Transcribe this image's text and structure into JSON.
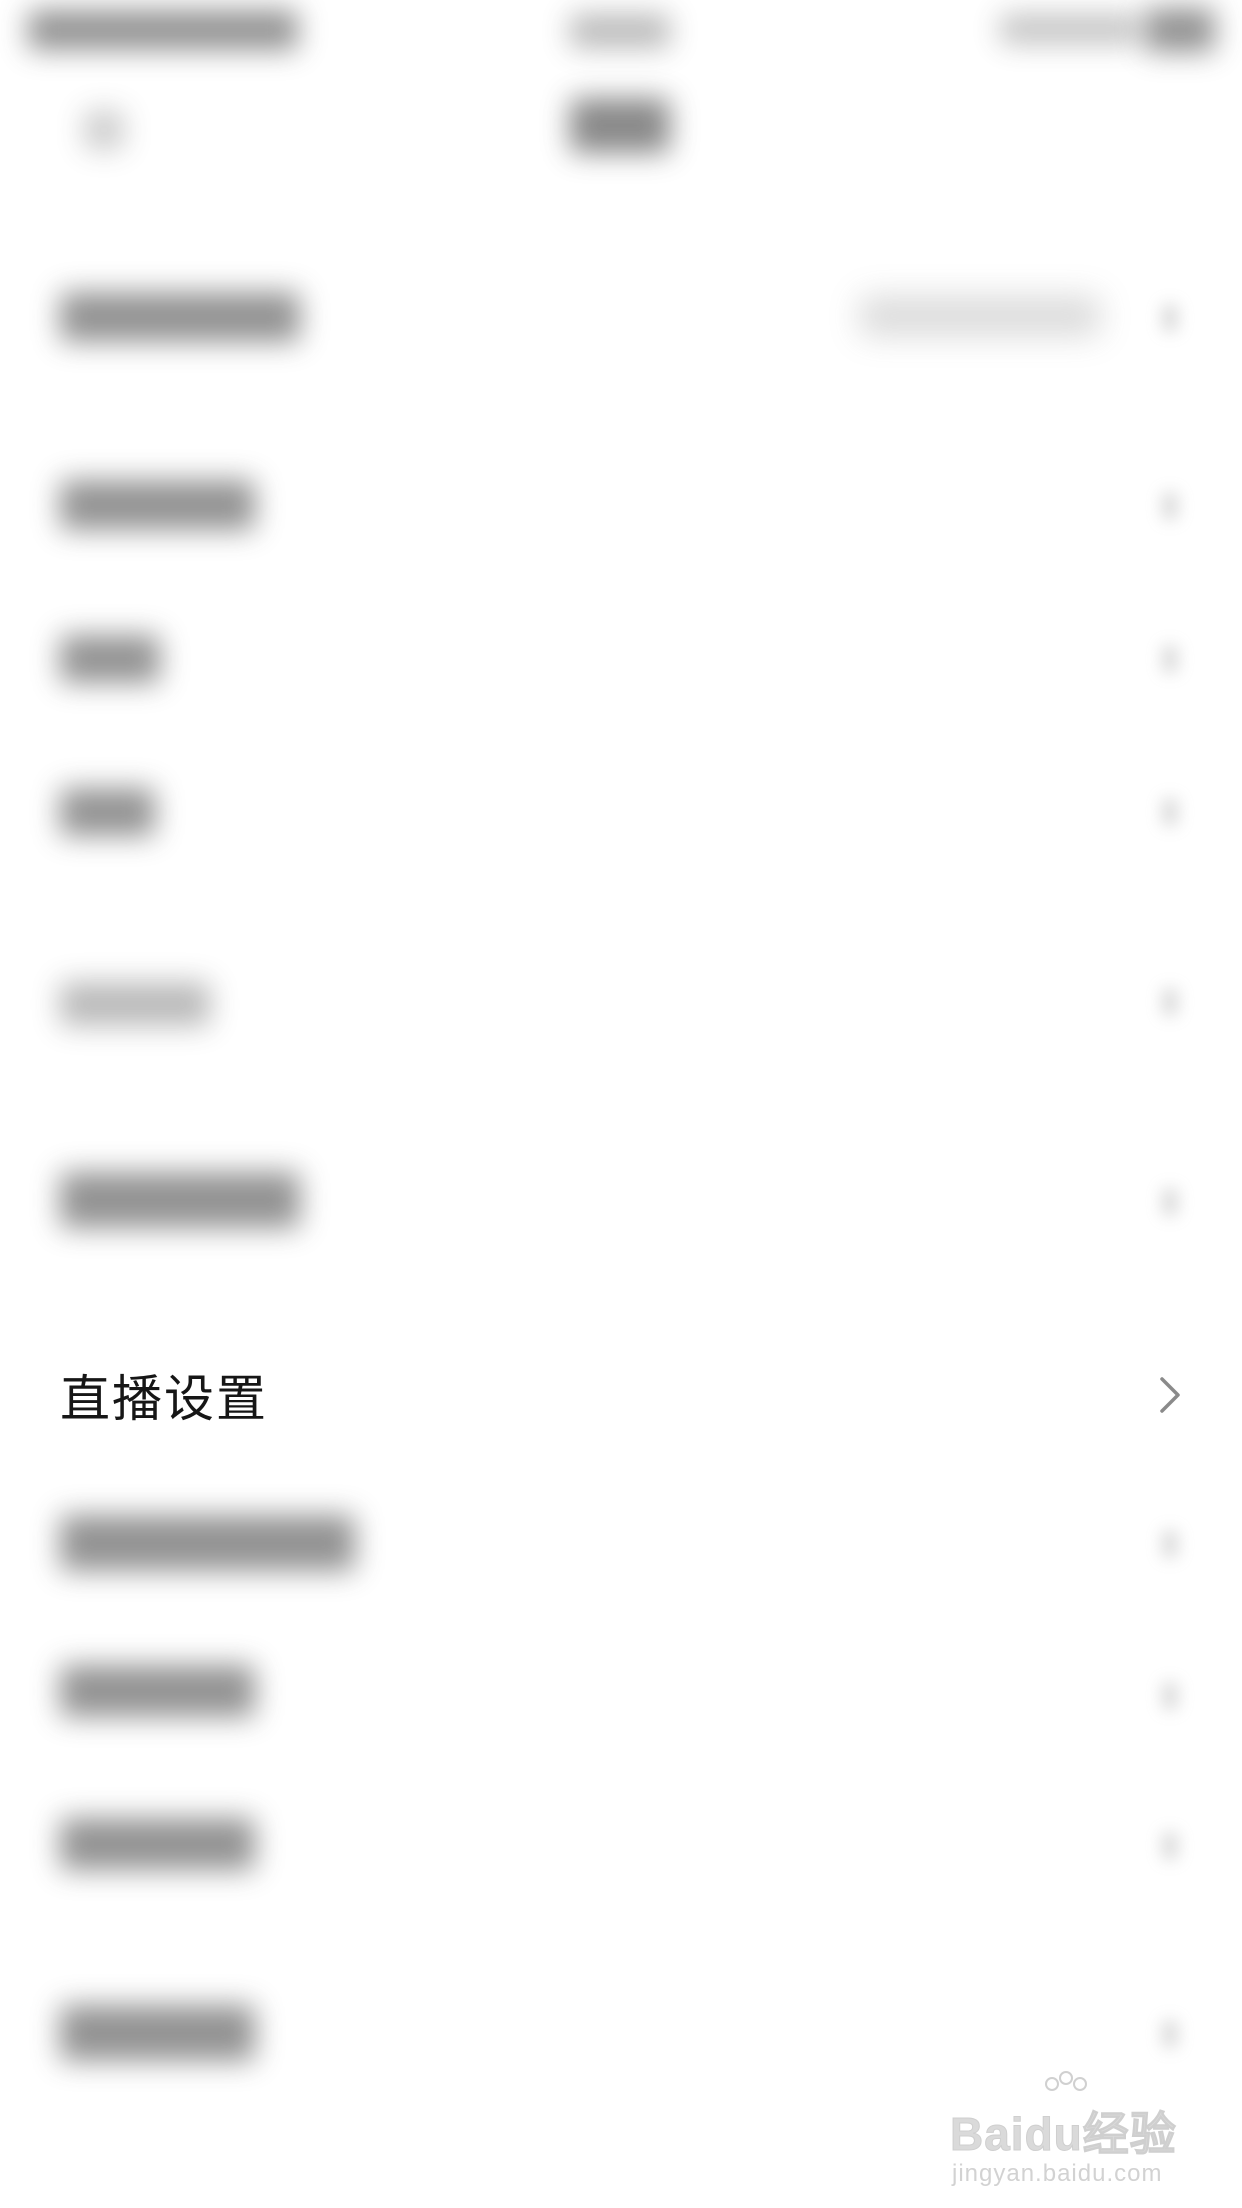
{
  "settings": {
    "focused_item": {
      "label": "直播设置",
      "icon": "chevron-right-icon"
    }
  },
  "watermark": {
    "brand": "Baidu经验",
    "url": "jingyan.baidu.com"
  },
  "colors": {
    "background": "#ffffff",
    "text": "#161616",
    "chevron": "#8a8a8a",
    "watermark": "#d6d6d6"
  }
}
